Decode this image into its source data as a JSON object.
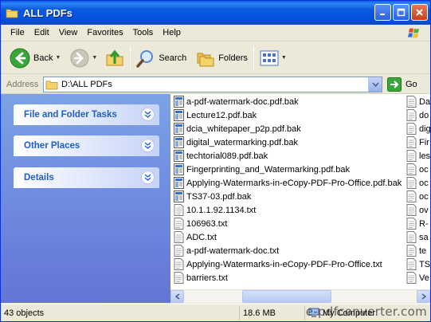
{
  "window": {
    "title": "ALL PDFs"
  },
  "menu": {
    "items": [
      {
        "label": "File"
      },
      {
        "label": "Edit"
      },
      {
        "label": "View"
      },
      {
        "label": "Favorites"
      },
      {
        "label": "Tools"
      },
      {
        "label": "Help"
      }
    ]
  },
  "toolbar": {
    "back_label": "Back",
    "search_label": "Search",
    "folders_label": "Folders"
  },
  "address": {
    "label": "Address",
    "value": "D:\\ALL PDFs",
    "go_label": "Go"
  },
  "tasks": {
    "file_folder": "File and Folder Tasks",
    "other_places": "Other Places",
    "details": "Details"
  },
  "files": {
    "col1": [
      "a-pdf-watermark-doc.pdf.bak",
      "Lecture12.pdf.bak",
      "dcia_whitepaper_p2p.pdf.bak",
      "digital_watermarking.pdf.bak",
      "techtorial089.pdf.bak",
      "Fingerprinting_and_Watermarking.pdf.bak",
      "Applying-Watermarks-in-eCopy-PDF-Pro-Office.pdf.bak",
      "TS37-03.pdf.bak",
      "10.1.1.92.1134.txt",
      "106963.txt",
      "ADC.txt",
      "a-pdf-watermark-doc.txt",
      "Applying-Watermarks-in-eCopy-PDF-Pro-Office.txt",
      "barriers.txt"
    ],
    "col2": [
      "Da",
      "do",
      "dig",
      "Fir",
      "les",
      "oc",
      "oc",
      "oc",
      "ov",
      "R-",
      "sa",
      "te",
      "TS",
      "Ve"
    ]
  },
  "status": {
    "objects": "43 objects",
    "size": "18.6 MB",
    "location": "My Computer"
  },
  "watermark": "e-pdfconverter.com"
}
